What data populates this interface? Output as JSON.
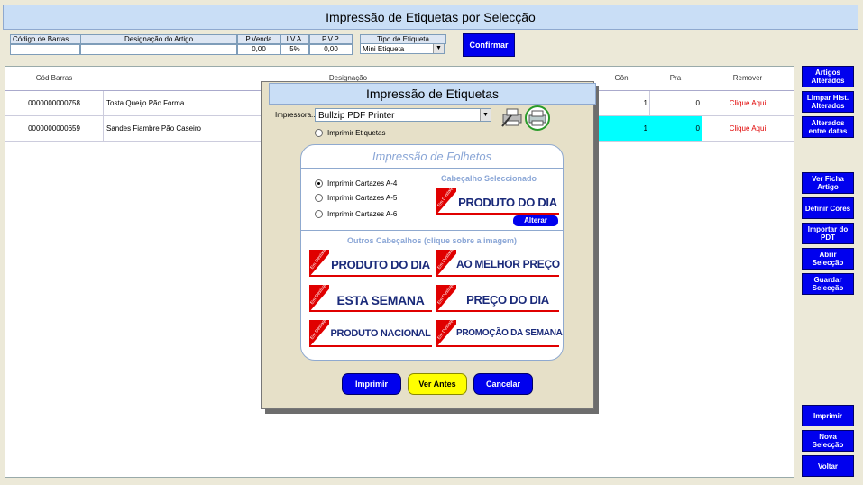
{
  "window": {
    "title": "Impressão de Etiquetas por Selecção"
  },
  "filter": {
    "headers": [
      "Código de Barras",
      "Designação do Artigo",
      "P.Venda",
      "I.V.A.",
      "P.V.P.",
      "Tipo de Etiqueta"
    ],
    "values": {
      "barcode": "",
      "designation": "",
      "pvenda": "0,00",
      "iva": "5%",
      "pvp": "0,00"
    },
    "tipo_selected": "Mini Etiqueta",
    "confirm_label": "Confirmar"
  },
  "grid": {
    "headers": [
      "Cód.Barras",
      "Designação",
      "Gôn",
      "Pra",
      "Remover"
    ],
    "rows": [
      {
        "barcode": "0000000000758",
        "designation": "Tosta Queijo Pão Forma",
        "gon": "1",
        "pra": "0",
        "remove": "Clique Aqui"
      },
      {
        "barcode": "0000000000659",
        "designation": "Sandes Fiambre Pão Caseiro",
        "gon": "1",
        "pra": "0",
        "remove": "Clique Aqui"
      }
    ]
  },
  "sidebar": {
    "top": [
      {
        "label": "Artigos Alterados"
      },
      {
        "label": "Limpar Hist. Alterados"
      },
      {
        "label": "Alterados entre datas"
      }
    ],
    "middle": [
      {
        "label": "Ver Ficha Artigo"
      },
      {
        "label": "Definir Cores"
      },
      {
        "label": "Importar do PDT"
      },
      {
        "label": "Abrir Selecção"
      },
      {
        "label": "Guardar Selecção"
      }
    ],
    "bottom": [
      {
        "label": "Imprimir"
      },
      {
        "label": "Nova Selecção"
      },
      {
        "label": "Voltar"
      }
    ]
  },
  "dialog": {
    "title": "Impressão de Etiquetas",
    "printer_label": "Impressora...",
    "printer_selected": "Bullzip PDF Printer",
    "print_labels_option": "Imprimir Etiquetas",
    "folhetos_title": "Impressão de Folhetos",
    "options": [
      "Imprimir Cartazes A-4",
      "Imprimir Cartazes A-5",
      "Imprimir Cartazes A-6"
    ],
    "selected_header_label": "Cabeçalho Seleccionado",
    "selected_header": "PRODUTO DO DIA",
    "alterar_label": "Alterar",
    "other_headers_label": "Outros Cabeçalhos (clique sobre a imagem)",
    "tag_text": "Em Destaque",
    "headers": [
      "PRODUTO DO DIA",
      "AO MELHOR PREÇO",
      "ESTA SEMANA",
      "PREÇO DO DIA",
      "PRODUTO NACIONAL",
      "PROMOÇÃO DA SEMANA"
    ],
    "buttons": {
      "print": "Imprimir",
      "preview": "Ver Antes",
      "cancel": "Cancelar"
    }
  },
  "colors": {
    "accent_blue": "#0000ee",
    "highlight_cyan": "#00ffff",
    "remove_red": "#e00000",
    "title_bg": "#c9def6",
    "preview_yellow": "#ffff00"
  }
}
